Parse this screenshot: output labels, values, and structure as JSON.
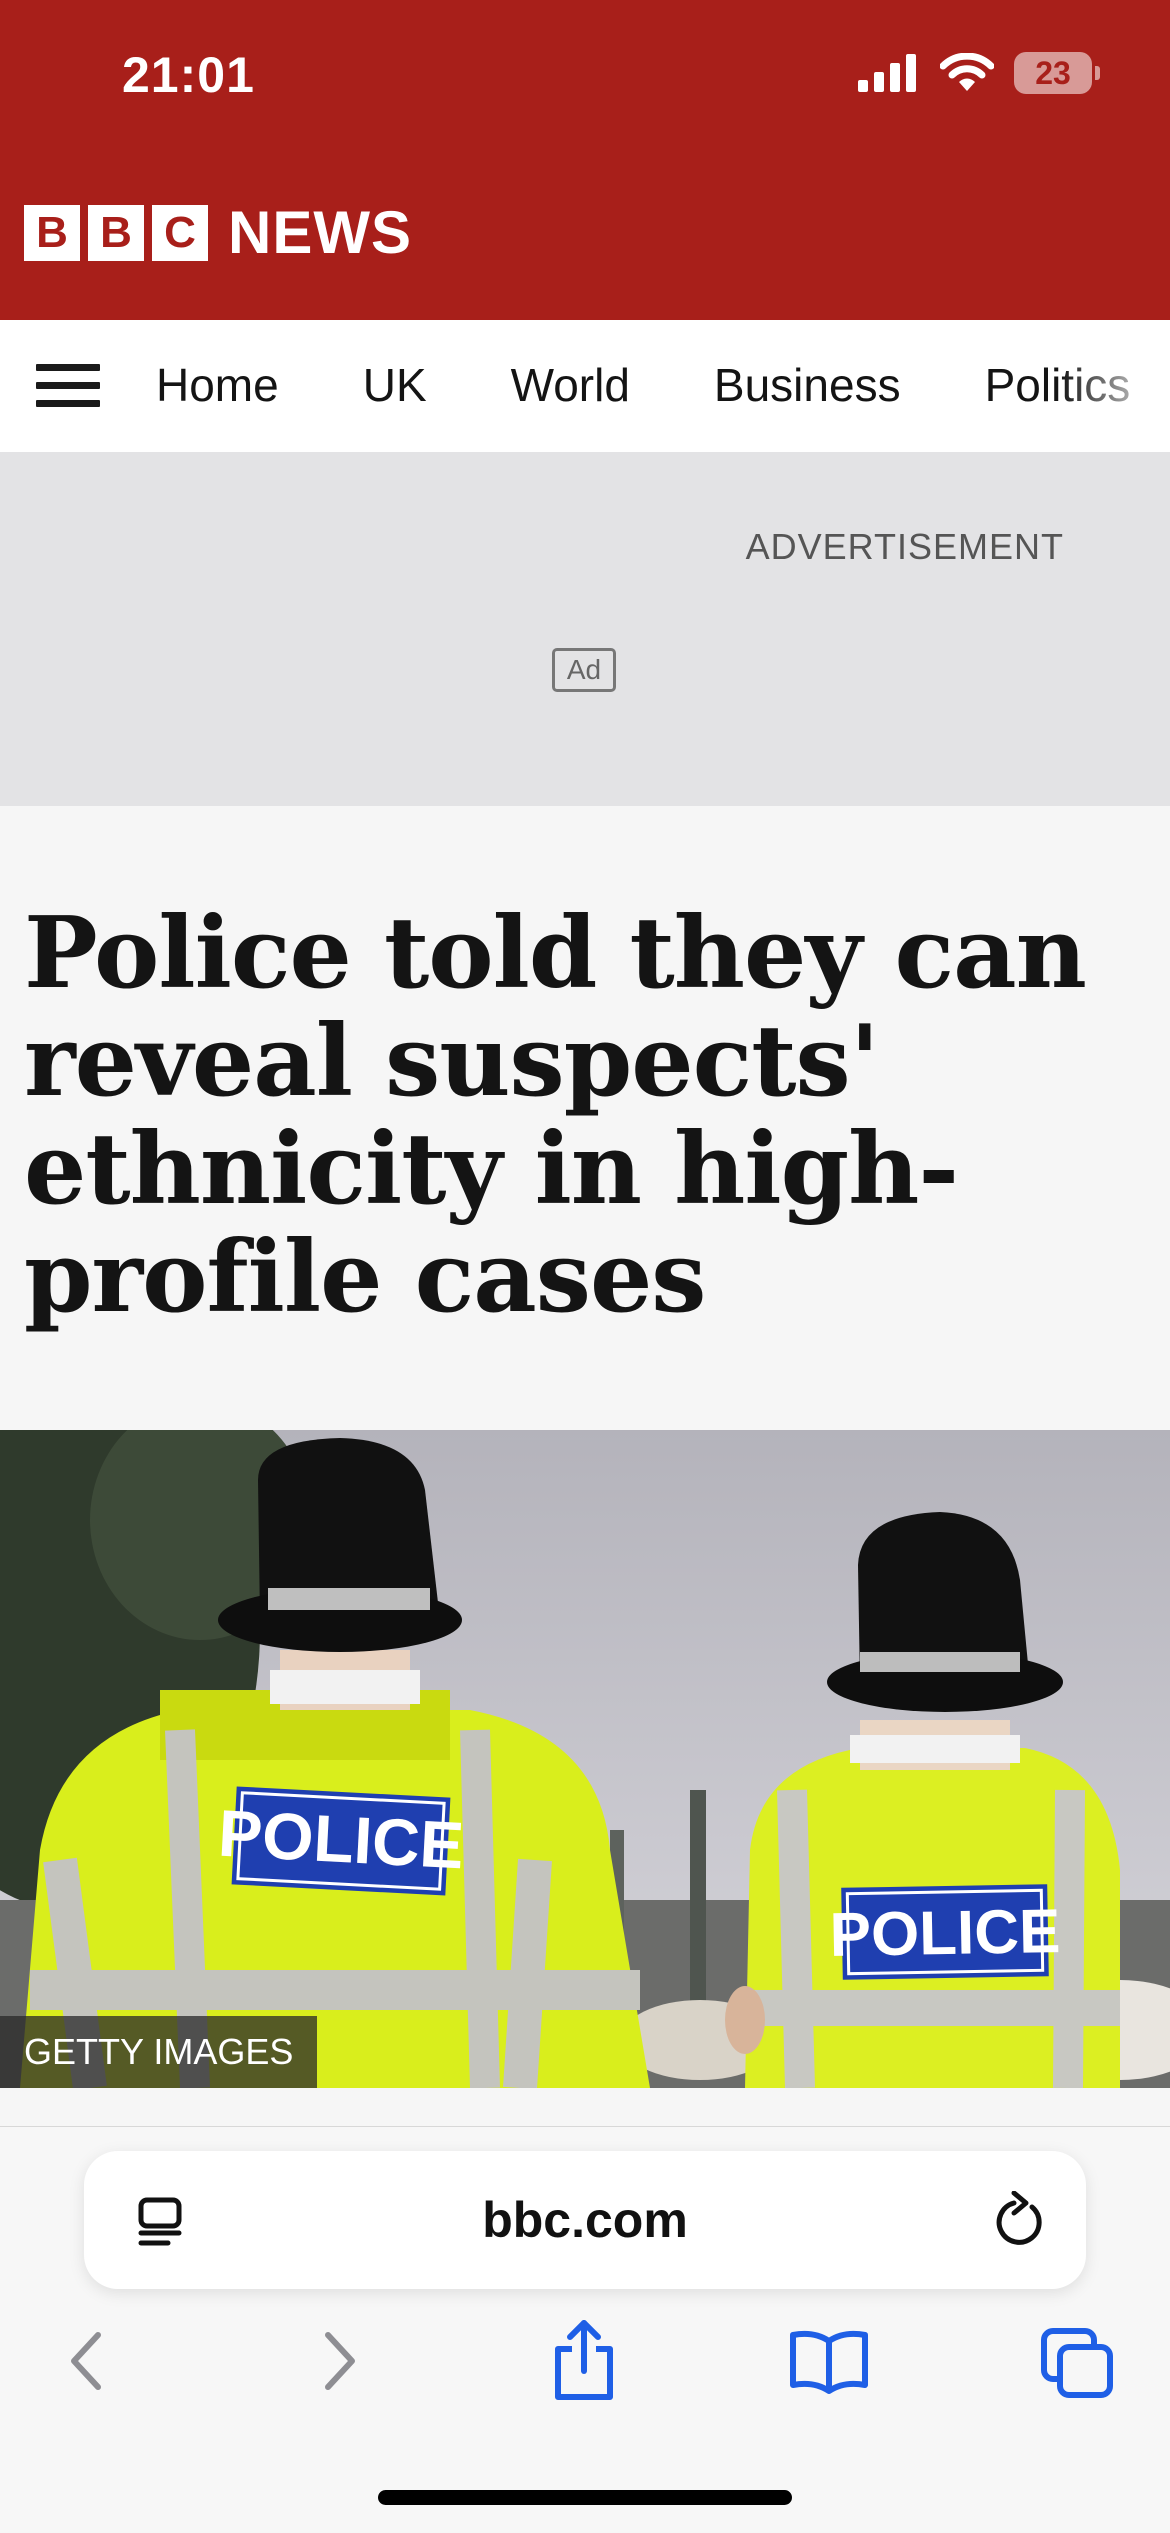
{
  "status": {
    "time": "21:01",
    "battery": "23"
  },
  "brand": {
    "letters": [
      "B",
      "B",
      "C"
    ],
    "name": "NEWS"
  },
  "nav": {
    "items": [
      "Home",
      "UK",
      "World",
      "Business",
      "Politics"
    ]
  },
  "ad": {
    "label": "ADVERTISEMENT",
    "badge": "Ad"
  },
  "article": {
    "headline": "Police told they can reveal suspects' ethnicity in high-profile cases",
    "image_credit": "GETTY IMAGES",
    "image_vest_text": "POLICE"
  },
  "browser": {
    "url": "bbc.com"
  },
  "colors": {
    "brand_red": "#a81f1a",
    "safari_blue": "#1f5fe6"
  }
}
